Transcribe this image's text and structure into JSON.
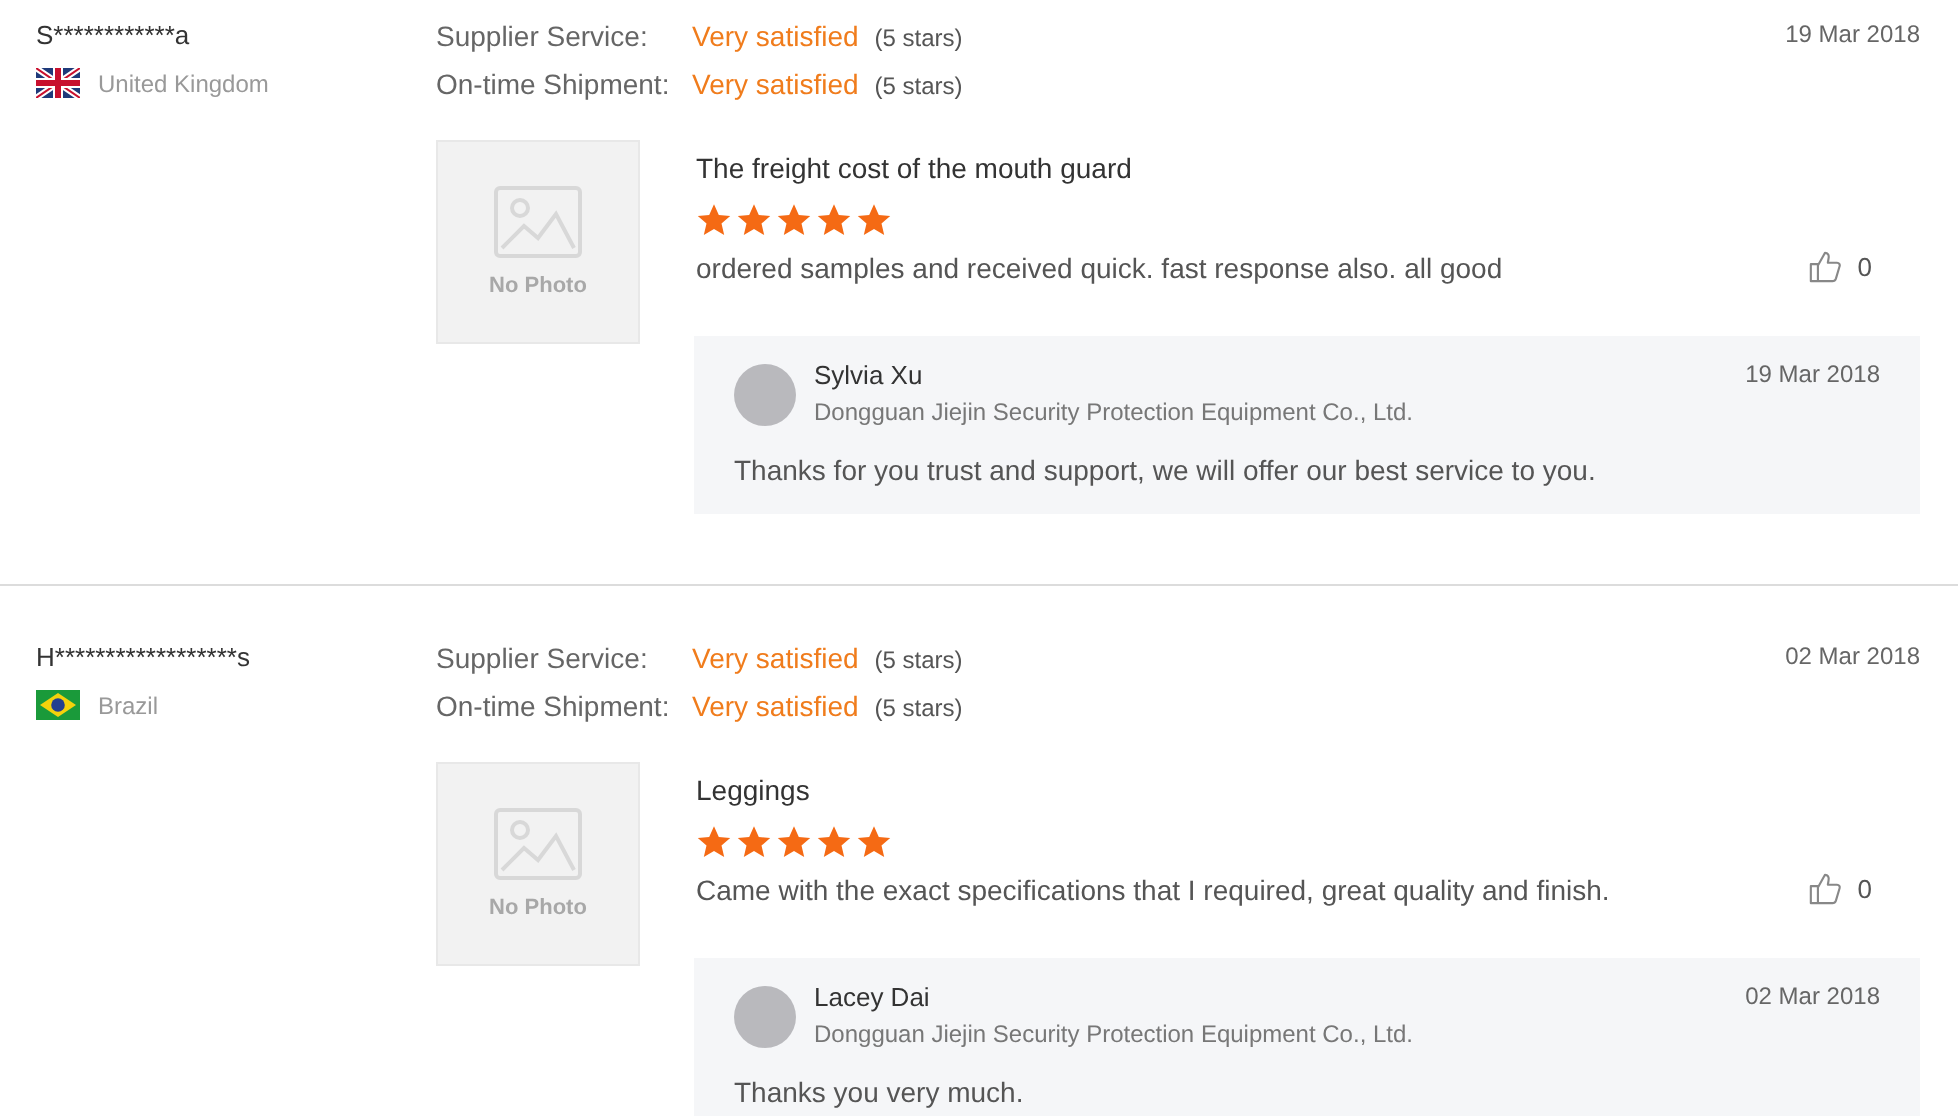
{
  "reviews": [
    {
      "buyer": "S************a",
      "country": "United Kingdom",
      "flag": {
        "kind": "gb"
      },
      "date": "19 Mar 2018",
      "ratings": [
        {
          "label": "Supplier Service:",
          "value": "Very satisfied",
          "note": "(5 stars)"
        },
        {
          "label": "On-time Shipment:",
          "value": "Very satisfied",
          "note": "(5 stars)"
        }
      ],
      "photo_text": "No Photo",
      "product": "The freight cost of the mouth guard",
      "stars": 5,
      "comment": "ordered samples and received quick. fast response also. all good",
      "likes": "0",
      "reply": {
        "name": "Sylvia Xu",
        "company": "Dongguan Jiejin Security Protection Equipment Co., Ltd.",
        "date": "19 Mar 2018",
        "text": "Thanks for you trust and support, we will offer our best service to you."
      }
    },
    {
      "buyer": "H******************s",
      "country": "Brazil",
      "flag": {
        "kind": "br"
      },
      "date": "02 Mar 2018",
      "ratings": [
        {
          "label": "Supplier Service:",
          "value": "Very satisfied",
          "note": "(5 stars)"
        },
        {
          "label": "On-time Shipment:",
          "value": "Very satisfied",
          "note": "(5 stars)"
        }
      ],
      "photo_text": "No Photo",
      "product": "Leggings",
      "stars": 5,
      "comment": "Came with the exact specifications that I required, great quality and finish.",
      "likes": "0",
      "reply": {
        "name": "Lacey Dai",
        "company": "Dongguan Jiejin Security Protection Equipment Co., Ltd.",
        "date": "02 Mar 2018",
        "text": "Thanks you very much."
      }
    }
  ]
}
